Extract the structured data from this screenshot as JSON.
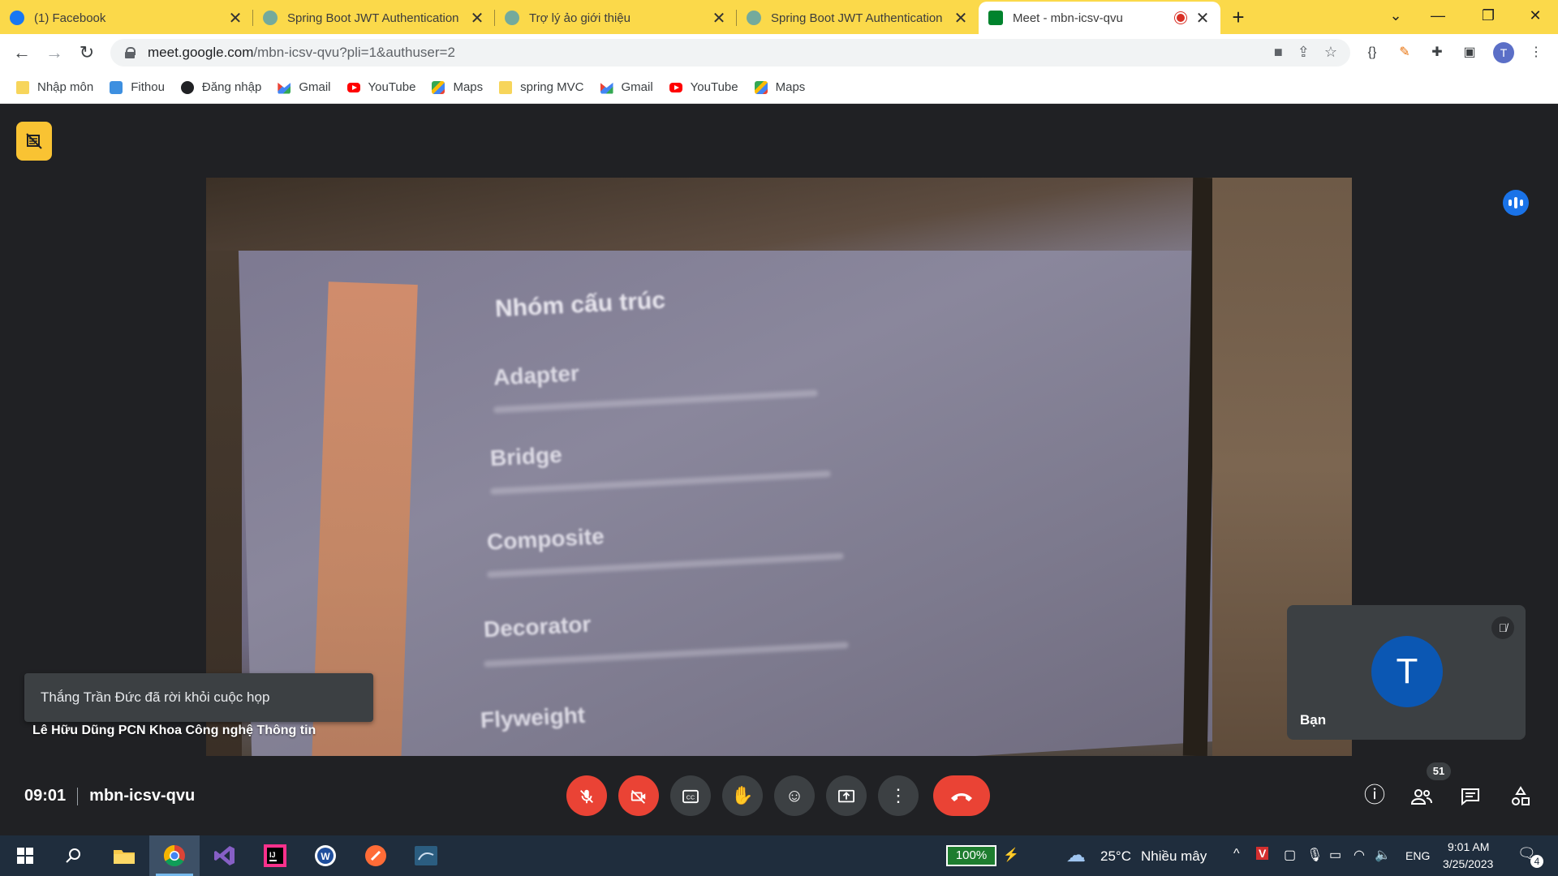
{
  "tabs": [
    {
      "title": "(1) Facebook",
      "icon": "facebook-icon",
      "color": "#1877f2"
    },
    {
      "title": "Spring Boot JWT Authentication",
      "icon": "chatgpt-icon",
      "color": "#74aa9c"
    },
    {
      "title": "Trợ lý ảo giới thiệu",
      "icon": "chatgpt-icon",
      "color": "#74aa9c"
    },
    {
      "title": "Spring Boot JWT Authentication",
      "icon": "chatgpt-icon",
      "color": "#74aa9c"
    },
    {
      "title": "Meet - mbn-icsv-qvu",
      "icon": "google-meet-icon",
      "color": "#00832d"
    }
  ],
  "address": {
    "host": "meet.google.com",
    "path": "/mbn-icsv-qvu?pli=1&authuser=2"
  },
  "profile_initial": "T",
  "bookmarks": [
    {
      "label": "Nhập môn",
      "icon": "folder-icon"
    },
    {
      "label": "Fithou",
      "icon": "fithou-icon"
    },
    {
      "label": "Đăng nhập",
      "icon": "globe-icon"
    },
    {
      "label": "Gmail",
      "icon": "gmail-icon"
    },
    {
      "label": "YouTube",
      "icon": "youtube-icon"
    },
    {
      "label": "Maps",
      "icon": "maps-icon"
    },
    {
      "label": "spring MVC",
      "icon": "folder-icon"
    },
    {
      "label": "Gmail",
      "icon": "gmail-icon"
    },
    {
      "label": "YouTube",
      "icon": "youtube-icon"
    },
    {
      "label": "Maps",
      "icon": "maps-icon"
    }
  ],
  "slide": {
    "title": "Nhóm cấu trúc",
    "items": [
      "Adapter",
      "Bridge",
      "Composite",
      "Decorator",
      "Flyweight"
    ]
  },
  "speaker_name": "Lê Hữu Dũng PCN Khoa Công nghệ Thông tin",
  "toast": "Thắng Trần Đức đã rời khỏi cuộc họp",
  "self_tile": {
    "initial": "T",
    "label": "Bạn",
    "avatar_color": "#0b57b3"
  },
  "meeting": {
    "time": "09:01",
    "code": "mbn-icsv-qvu",
    "participants": "51"
  },
  "accent_red": "#ea4335",
  "taskbar": {
    "battery": "100%",
    "weather_temp": "25°C",
    "weather_desc": "Nhiều mây",
    "lang": "ENG",
    "clock_time": "9:01 AM",
    "clock_date": "3/25/2023",
    "notifications": "4"
  }
}
